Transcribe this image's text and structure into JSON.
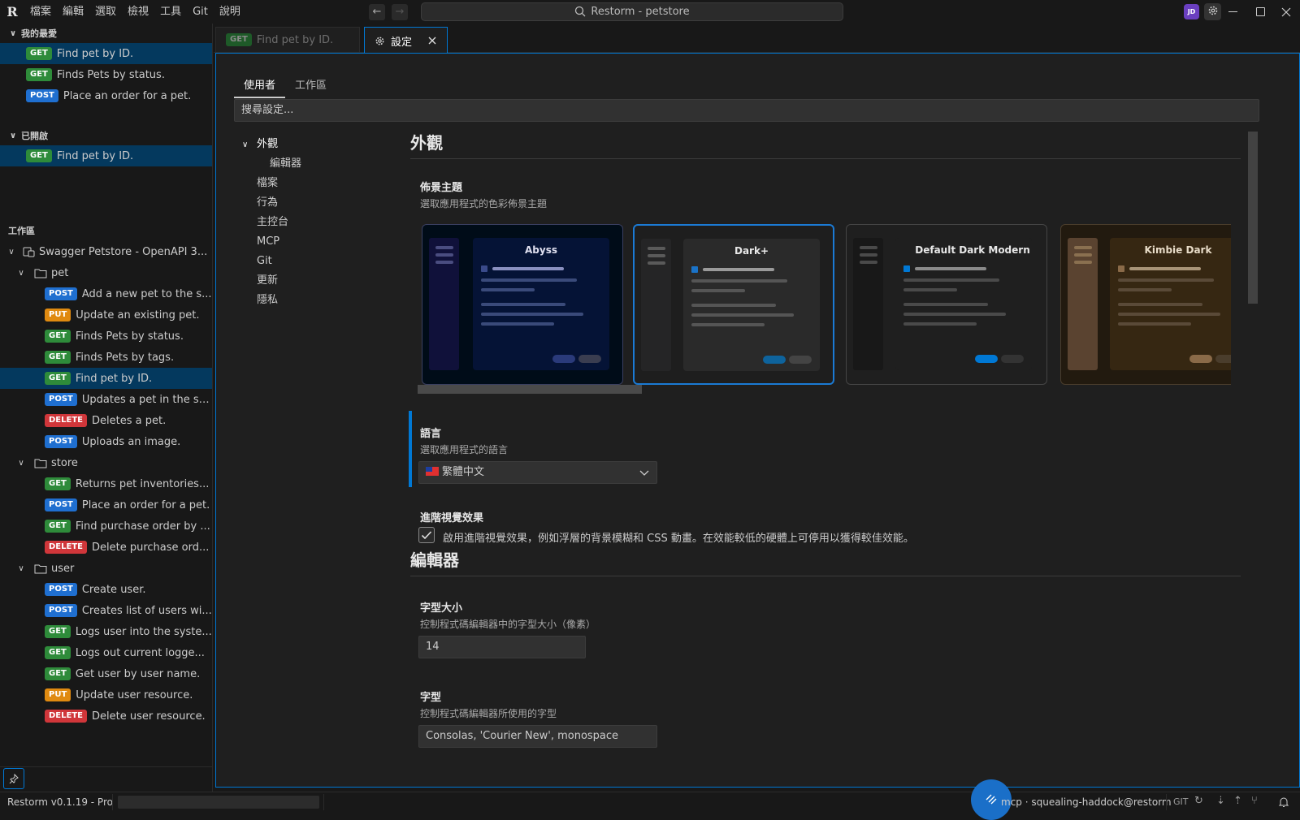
{
  "app": {
    "menu": [
      "檔案",
      "編輯",
      "選取",
      "檢視",
      "工具",
      "Git",
      "說明"
    ],
    "command_center": "Restorm - petstore",
    "avatar_initials": "JD"
  },
  "favorites": {
    "title": "我的最愛",
    "items": [
      {
        "method": "GET",
        "label": "Find pet by ID."
      },
      {
        "method": "GET",
        "label": "Finds Pets by status."
      },
      {
        "method": "POST",
        "label": "Place an order for a pet."
      }
    ]
  },
  "opened": {
    "title": "已開啟",
    "items": [
      {
        "method": "GET",
        "label": "Find pet by ID."
      }
    ]
  },
  "workspace": {
    "title": "工作區",
    "project": "Swagger Petstore - OpenAPI 3...",
    "folders": [
      {
        "name": "pet",
        "items": [
          {
            "method": "POST",
            "label": "Add a new pet to the s..."
          },
          {
            "method": "PUT",
            "label": "Update an existing pet."
          },
          {
            "method": "GET",
            "label": "Finds Pets by status."
          },
          {
            "method": "GET",
            "label": "Finds Pets by tags."
          },
          {
            "method": "GET",
            "label": "Find pet by ID."
          },
          {
            "method": "POST",
            "label": "Updates a pet in the st..."
          },
          {
            "method": "DELETE",
            "label": "Deletes a pet."
          },
          {
            "method": "POST",
            "label": "Uploads an image."
          }
        ]
      },
      {
        "name": "store",
        "items": [
          {
            "method": "GET",
            "label": "Returns pet inventories..."
          },
          {
            "method": "POST",
            "label": "Place an order for a pet."
          },
          {
            "method": "GET",
            "label": "Find purchase order by ..."
          },
          {
            "method": "DELETE",
            "label": "Delete purchase ord..."
          }
        ]
      },
      {
        "name": "user",
        "items": [
          {
            "method": "POST",
            "label": "Create user."
          },
          {
            "method": "POST",
            "label": "Creates list of users wi..."
          },
          {
            "method": "GET",
            "label": "Logs user into the syste..."
          },
          {
            "method": "GET",
            "label": "Logs out current logge..."
          },
          {
            "method": "GET",
            "label": "Get user by user name."
          },
          {
            "method": "PUT",
            "label": "Update user resource."
          },
          {
            "method": "DELETE",
            "label": "Delete user resource."
          }
        ]
      }
    ]
  },
  "tabs": {
    "tab1": {
      "method": "GET",
      "label": "Find pet by ID."
    },
    "tab2": {
      "label": "設定"
    }
  },
  "settings": {
    "subtabs": [
      "使用者",
      "工作區"
    ],
    "search_placeholder": "搜尋設定...",
    "toc": {
      "appearance": "外觀",
      "editor_sub": "編輯器",
      "items": [
        "檔案",
        "行為",
        "主控台",
        "MCP",
        "Git",
        "更新",
        "隱私"
      ]
    },
    "appearance_heading": "外觀",
    "theme": {
      "title": "佈景主題",
      "desc": "選取應用程式的色彩佈景主題",
      "options": [
        "Abyss",
        "Dark+",
        "Default Dark Modern",
        "Kimbie Dark"
      ],
      "selected": "Dark+"
    },
    "language": {
      "title": "語言",
      "desc": "選取應用程式的語言",
      "value": "繁體中文"
    },
    "advanced_effects": {
      "title": "進階視覺效果",
      "label": "啟用進階視覺效果，例如浮層的背景模糊和 CSS 動畫。在效能較低的硬體上可停用以獲得較佳效能。",
      "checked": true
    },
    "editor_heading": "編輯器",
    "font_size": {
      "title": "字型大小",
      "desc": "控制程式碼編輯器中的字型大小（像素）",
      "value": "14"
    },
    "font_family": {
      "title": "字型",
      "desc": "控制程式碼編輯器所使用的字型",
      "value": "Consolas, 'Courier New', monospace"
    }
  },
  "statusbar": {
    "version": "Restorm v0.1.19 - Pro",
    "mcp": "mcp · squealing-haddock@restorm",
    "git": "GIT"
  },
  "colors": {
    "accent": "#0078d4",
    "get": "#2e8b3a",
    "post": "#1f6fd0",
    "put": "#e08a10",
    "delete": "#d0363a"
  }
}
